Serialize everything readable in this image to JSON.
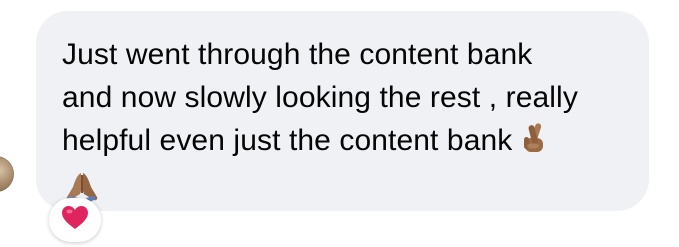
{
  "message": {
    "line1": "Just went through the content bank",
    "line2": "and now slowly looking the rest , really",
    "line3": "helpful even just the content bank",
    "emoji_after_line3": "crossed-fingers-icon",
    "emoji_line4": "folded-hands-icon"
  },
  "reaction": {
    "icon": "red-heart-icon"
  },
  "colors": {
    "bubble": "#eff1f5",
    "text": "#050505",
    "heart": "#e0245e",
    "skin": "#a87a55"
  }
}
